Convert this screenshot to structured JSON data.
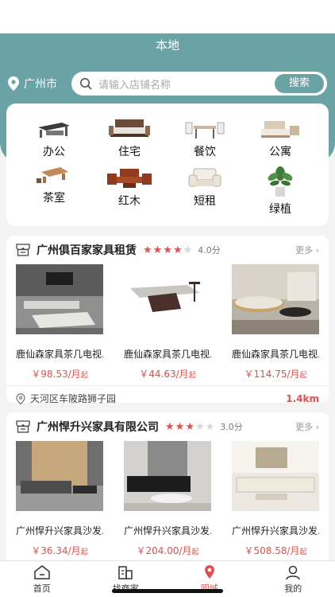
{
  "header": {
    "title": "本地"
  },
  "location": {
    "city": "广州市"
  },
  "search": {
    "placeholder": "请输入店铺名称",
    "button_label": "搜索"
  },
  "categories": [
    {
      "label": "办公",
      "icon": "office-furniture-icon"
    },
    {
      "label": "住宅",
      "icon": "bed-icon"
    },
    {
      "label": "餐饮",
      "icon": "dining-table-icon"
    },
    {
      "label": "公寓",
      "icon": "apartment-bed-icon"
    },
    {
      "label": "茶室",
      "icon": "tea-table-icon"
    },
    {
      "label": "红木",
      "icon": "rosewood-sofa-icon"
    },
    {
      "label": "短租",
      "icon": "armchair-icon"
    },
    {
      "label": "绿植",
      "icon": "plant-icon"
    }
  ],
  "shops": [
    {
      "name": "广州俱百家家具租赁",
      "rating": 4,
      "score": "4.0分",
      "more": "更多",
      "products": [
        {
          "name": "鹿仙森家具茶几电视...",
          "price": "￥98.53/月",
          "unit": "起"
        },
        {
          "name": "鹿仙森家具茶几电视...",
          "price": "￥44.63/月",
          "unit": "起"
        },
        {
          "name": "鹿仙森家具茶几电视...",
          "price": "￥114.75/月",
          "unit": "起"
        }
      ],
      "address": "天河区车陂路狮子园",
      "distance": "1.4km"
    },
    {
      "name": "广州悍升兴家具有限公司",
      "rating": 3,
      "score": "3.0分",
      "more": "更多",
      "products": [
        {
          "name": "广州悍升兴家具沙发...",
          "price": "￥36.34/月",
          "unit": "起"
        },
        {
          "name": "广州悍升兴家具沙发...",
          "price": "￥204.00/月",
          "unit": "起"
        },
        {
          "name": "广州悍升兴家具沙发...",
          "price": "￥508.58/月",
          "unit": "起"
        }
      ]
    }
  ],
  "tabbar": [
    {
      "label": "首页",
      "icon": "home-icon"
    },
    {
      "label": "找商家",
      "icon": "building-icon"
    },
    {
      "label": "同城",
      "icon": "location-pin-icon"
    },
    {
      "label": "我的",
      "icon": "user-icon"
    }
  ],
  "colors": {
    "accent": "#6aa3a5",
    "price": "#e0514e"
  }
}
